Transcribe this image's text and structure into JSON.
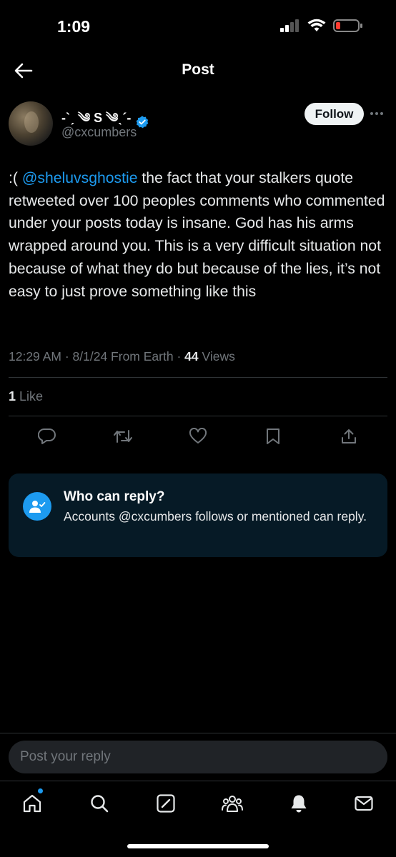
{
  "status_bar": {
    "time": "1:09"
  },
  "nav": {
    "title": "Post"
  },
  "author": {
    "display_name": "-`ˏ ༄ S ༄ˎ´-",
    "handle": "@cxcumbers",
    "follow_label": "Follow"
  },
  "post": {
    "prefix": ":( ",
    "mention": "@sheluvsghostie",
    "text": " the fact that your stalkers quote retweeted over 100 peoples comments who commented under your posts today is insane. God has his arms wrapped around you. This is a very difficult situation not because of what they do but because of the lies, it’s not easy to just prove something like this",
    "time": "12:29 AM",
    "date": "8/1/24",
    "location": "From Earth",
    "views_count": "44",
    "views_label": "Views",
    "likes_count": "1",
    "likes_label": "Like"
  },
  "reply_restriction": {
    "title": "Who can reply?",
    "description": "Accounts @cxcumbers follows or mentioned can reply."
  },
  "compose": {
    "placeholder": "Post your reply"
  },
  "icons": {
    "actions": [
      "reply-icon",
      "repost-icon",
      "like-icon",
      "bookmark-icon",
      "share-icon"
    ],
    "tabs": [
      "home-icon",
      "search-icon",
      "grok-icon",
      "communities-icon",
      "notifications-icon",
      "messages-icon"
    ]
  },
  "colors": {
    "accent": "#1d9bf0",
    "background": "#000000",
    "card": "#061a26",
    "muted": "#71767b"
  }
}
